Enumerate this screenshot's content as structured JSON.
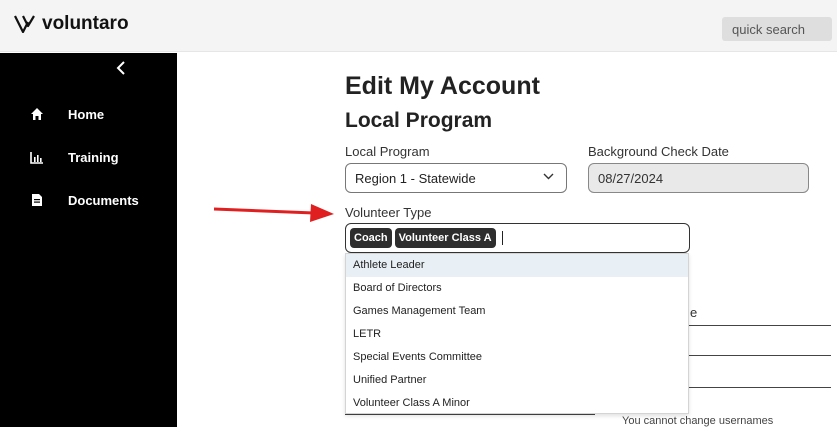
{
  "app": {
    "name": "voluntaro"
  },
  "search": {
    "placeholder": "quick search"
  },
  "sidebar": {
    "collapse_glyph": "‹",
    "items": [
      {
        "label": "Home",
        "icon": "home-icon"
      },
      {
        "label": "Training",
        "icon": "chart-icon"
      },
      {
        "label": "Documents",
        "icon": "document-icon"
      }
    ]
  },
  "page": {
    "title": "Edit My Account",
    "section": "Local Program"
  },
  "form": {
    "local_program": {
      "label": "Local Program",
      "value": "Region 1 - Statewide"
    },
    "background_check": {
      "label": "Background Check Date",
      "value": "08/27/2024"
    },
    "volunteer_type": {
      "label": "Volunteer Type",
      "selected": [
        "Coach",
        "Volunteer Class A"
      ],
      "options": [
        "Athlete Leader",
        "Board of Directors",
        "Games Management Team",
        "LETR",
        "Special Events Committee",
        "Unified Partner",
        "Volunteer Class A Minor"
      ]
    },
    "partial_label": "e",
    "username_help": "You cannot change usernames"
  },
  "colors": {
    "sidebar_bg": "#000000",
    "topbar_bg": "#f4f4f4",
    "arrow": "#e02020",
    "highlight_option": "#e9f0f5"
  }
}
